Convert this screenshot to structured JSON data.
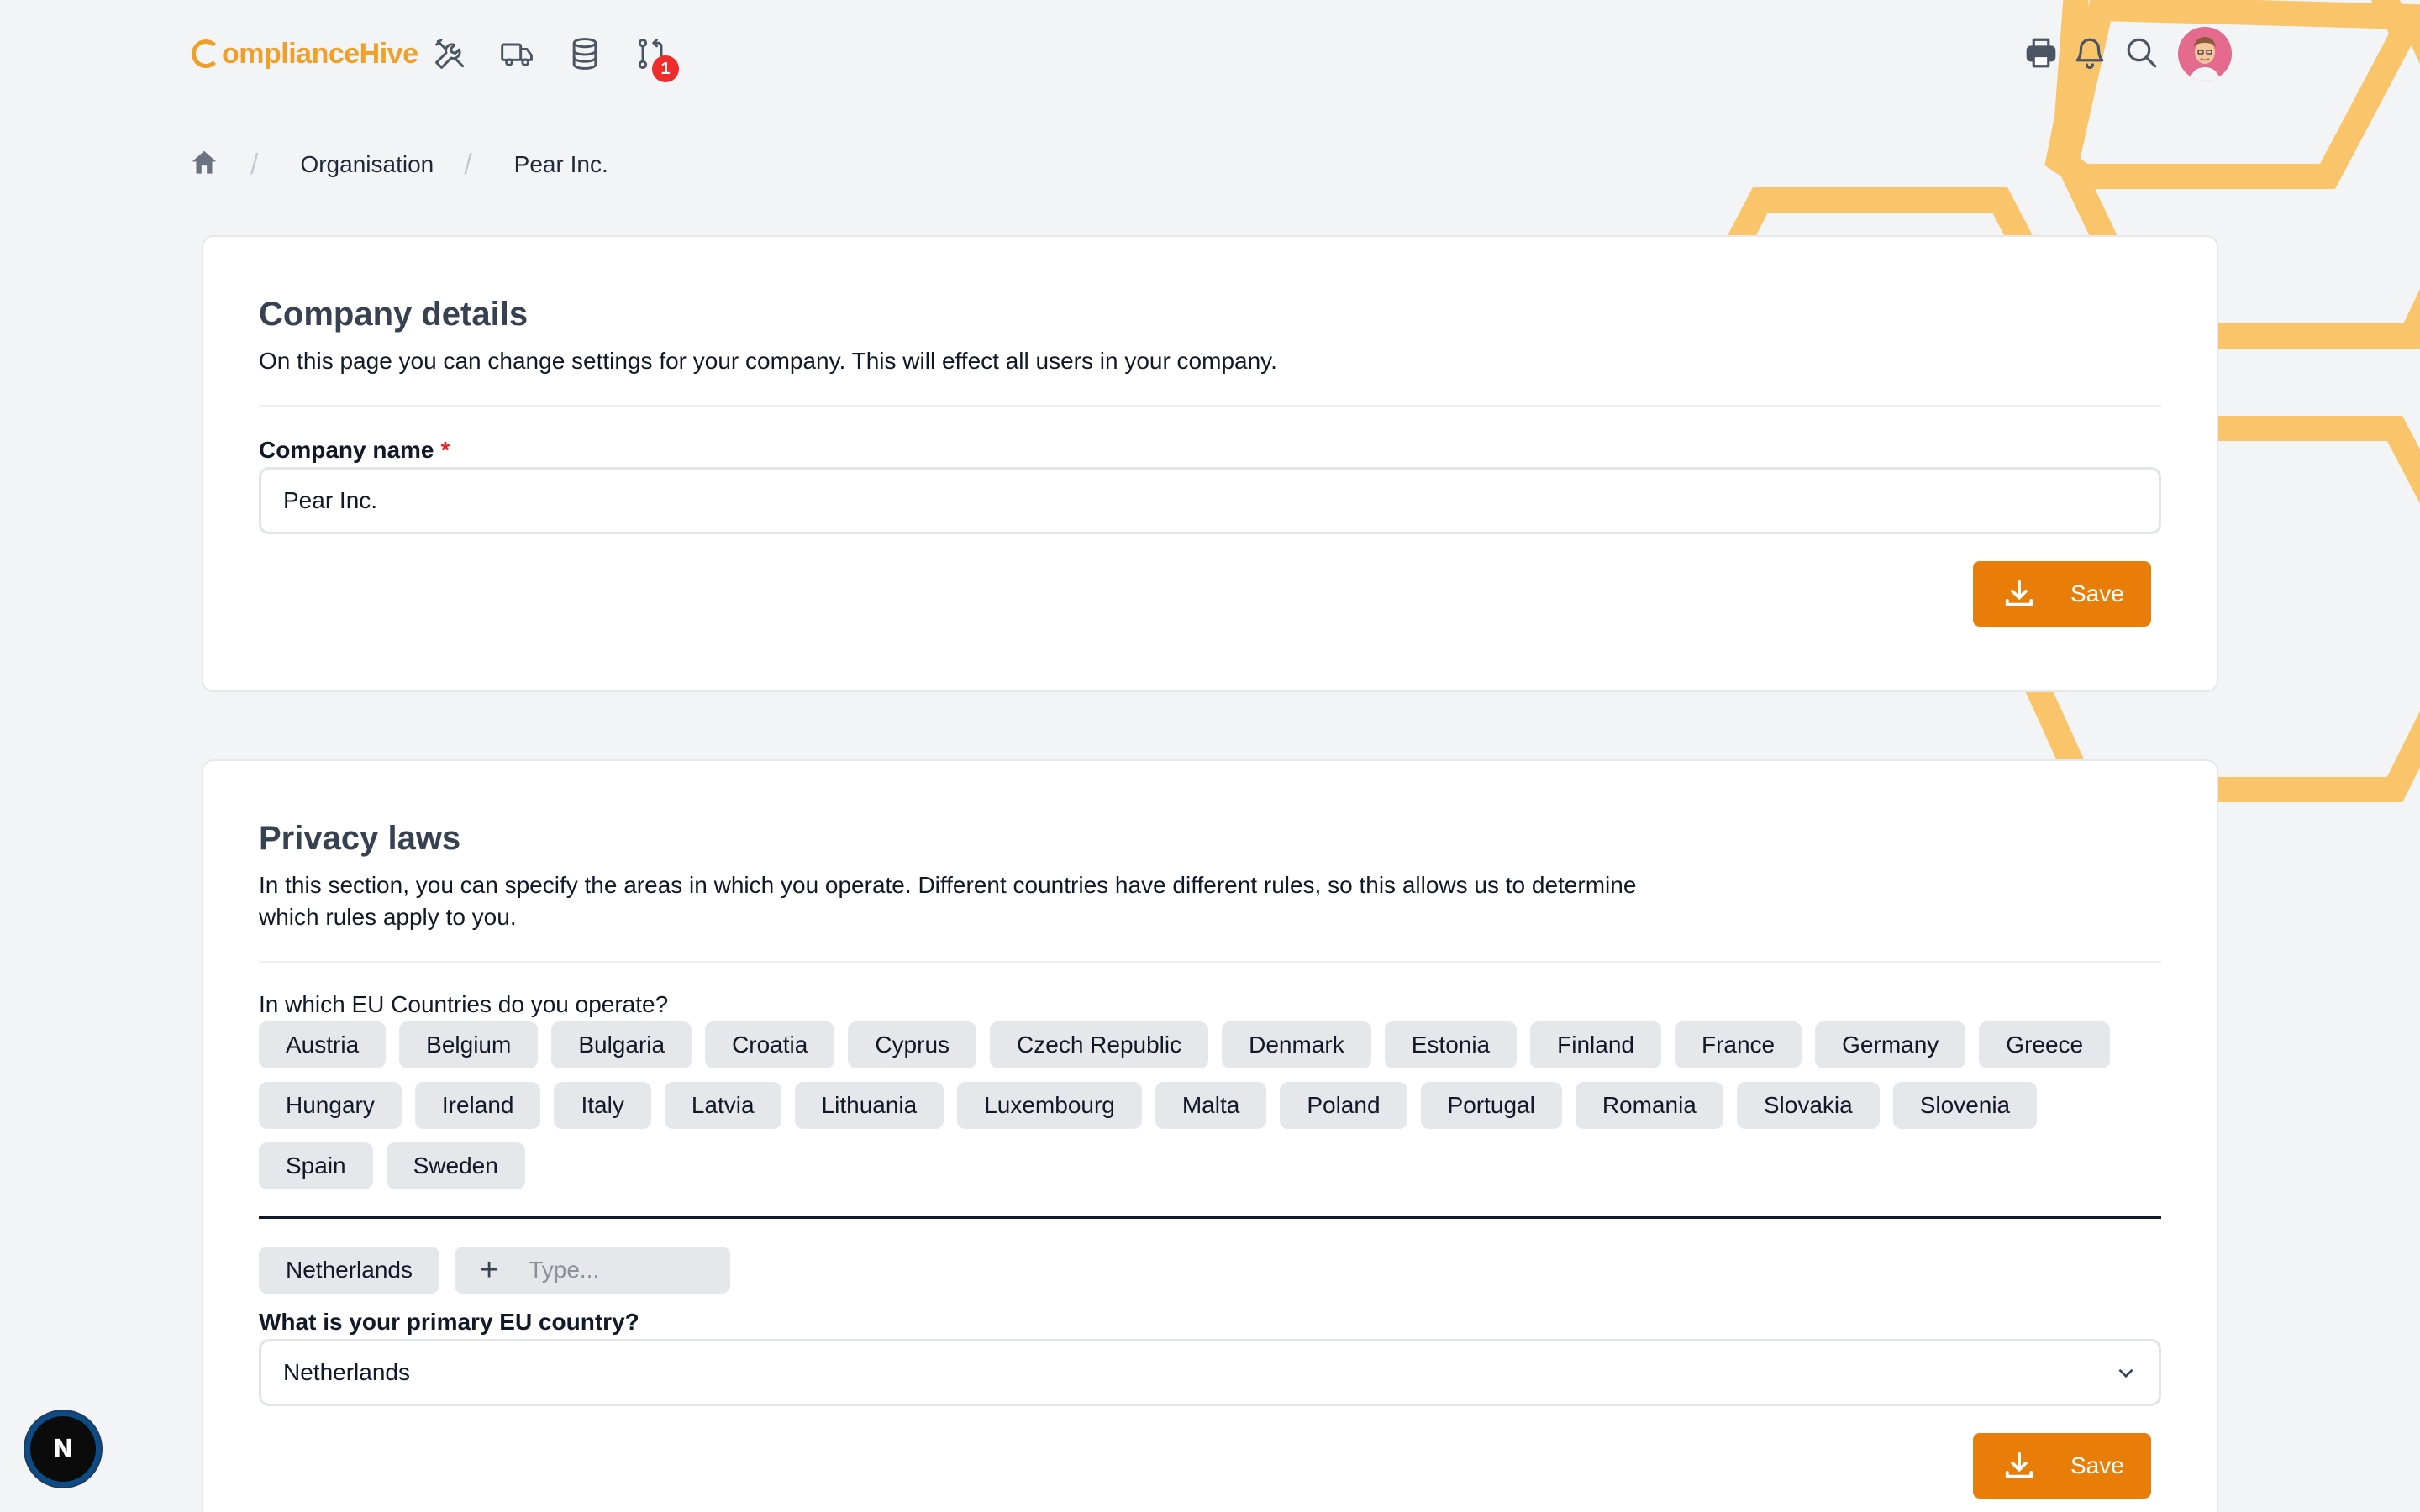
{
  "brand": {
    "logo_text": "omplianceHive",
    "accent": "#e97d0a",
    "hex_color": "#f9c46a"
  },
  "nav": {
    "icons": [
      "tools-icon",
      "truck-icon",
      "database-icon",
      "git-pull-request-icon"
    ],
    "notification_count": "1",
    "right_icons": [
      "printer-icon",
      "bell-icon",
      "search-icon",
      "avatar"
    ]
  },
  "breadcrumb": {
    "home": "home-icon",
    "items": [
      "Organisation",
      "Pear Inc."
    ]
  },
  "company": {
    "title": "Company details",
    "description": "On this page you can change settings for your company. This will effect all users in your company.",
    "name_label": "Company name",
    "required_mark": "*",
    "name_value": "Pear Inc.",
    "save_label": "Save"
  },
  "privacy": {
    "title": "Privacy laws",
    "description_line1": "In this section, you can specify the areas in which you operate. Different countries have different rules, so this allows us to determine",
    "description_line2": "which rules apply to you.",
    "countries_question": "In which EU Countries do you operate?",
    "countries": [
      "Austria",
      "Belgium",
      "Bulgaria",
      "Croatia",
      "Cyprus",
      "Czech Republic",
      "Denmark",
      "Estonia",
      "Finland",
      "France",
      "Germany",
      "Greece",
      "Hungary",
      "Ireland",
      "Italy",
      "Latvia",
      "Lithuania",
      "Luxembourg",
      "Malta",
      "Poland",
      "Portugal",
      "Romania",
      "Slovakia",
      "Slovenia",
      "Spain",
      "Sweden"
    ],
    "selected": [
      "Netherlands"
    ],
    "type_placeholder": "Type...",
    "primary_label": "What is your primary EU country?",
    "primary_value": "Netherlands",
    "save_label": "Save"
  },
  "dev_badge": "N"
}
